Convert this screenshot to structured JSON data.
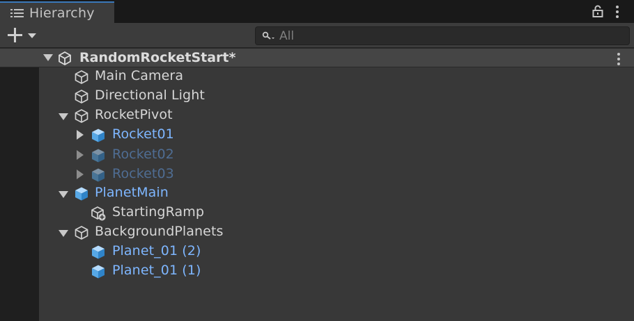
{
  "tab": {
    "title": "Hierarchy"
  },
  "search": {
    "placeholder": "All"
  },
  "scene": {
    "name": "RandomRocketStart*"
  },
  "objects": [
    {
      "label": "Main Camera",
      "type": "gameobject",
      "foldout": "none"
    },
    {
      "label": "Directional Light",
      "type": "gameobject",
      "foldout": "none"
    },
    {
      "label": "RocketPivot",
      "type": "gameobject",
      "foldout": "expanded"
    },
    {
      "label": "Rocket01",
      "type": "prefab",
      "foldout": "collapsed"
    },
    {
      "label": "Rocket02",
      "type": "prefab-inactive",
      "foldout": "collapsed"
    },
    {
      "label": "Rocket03",
      "type": "prefab-inactive",
      "foldout": "collapsed"
    },
    {
      "label": "PlanetMain",
      "type": "prefab",
      "foldout": "expanded"
    },
    {
      "label": "StartingRamp",
      "type": "added-gameobject",
      "foldout": "none"
    },
    {
      "label": "BackgroundPlanets",
      "type": "gameobject",
      "foldout": "expanded"
    },
    {
      "label": "Planet_01 (2)",
      "type": "prefab",
      "foldout": "none"
    },
    {
      "label": "Planet_01 (1)",
      "type": "prefab",
      "foldout": "none"
    }
  ],
  "colors": {
    "accent_tab": "#3a79bb",
    "prefab_text": "#7eb6ff",
    "inactive_prefab_text": "#4f6d93",
    "gameobject_text": "#d6d6d6"
  }
}
